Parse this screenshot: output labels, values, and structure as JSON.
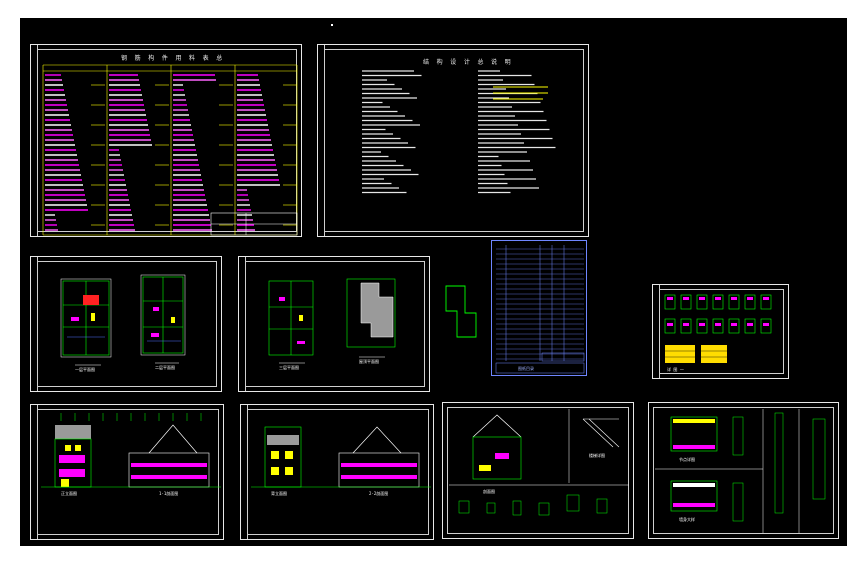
{
  "window": {
    "top_marker": "±"
  },
  "sheets": {
    "materials_table": {
      "title": "钢 筋 构 件 用 料 表 总"
    },
    "design_notes": {
      "title": "结 构 设 计 总 说 明"
    },
    "floorplan_a": {
      "cap_left": "一层平面图",
      "cap_right": "二层平面图"
    },
    "floorplan_b": {
      "cap_left": "三层平面图",
      "cap_right": "屋顶平面图"
    },
    "drawing_list": {
      "footer": "图纸目录"
    },
    "details_small": {
      "caption": "详 图 一"
    },
    "elev_a": {
      "cap_left": "正立面图",
      "cap_right": "1-1剖面图"
    },
    "elev_b": {
      "cap_left": "背立面图",
      "cap_right": "2-2剖面图"
    },
    "section_c": {
      "cap_left": "剖面图",
      "cap_right": "楼梯详图"
    },
    "details_d": {
      "cap_left": "节点详图",
      "cap_right": "墙身大样"
    }
  },
  "colors": {
    "background": "#000000",
    "frame": "#ffffff",
    "green": "#00ff00",
    "magenta": "#ff00ff",
    "yellow": "#ffff00",
    "cyan": "#00ffff",
    "blue": "#4f6fff"
  }
}
